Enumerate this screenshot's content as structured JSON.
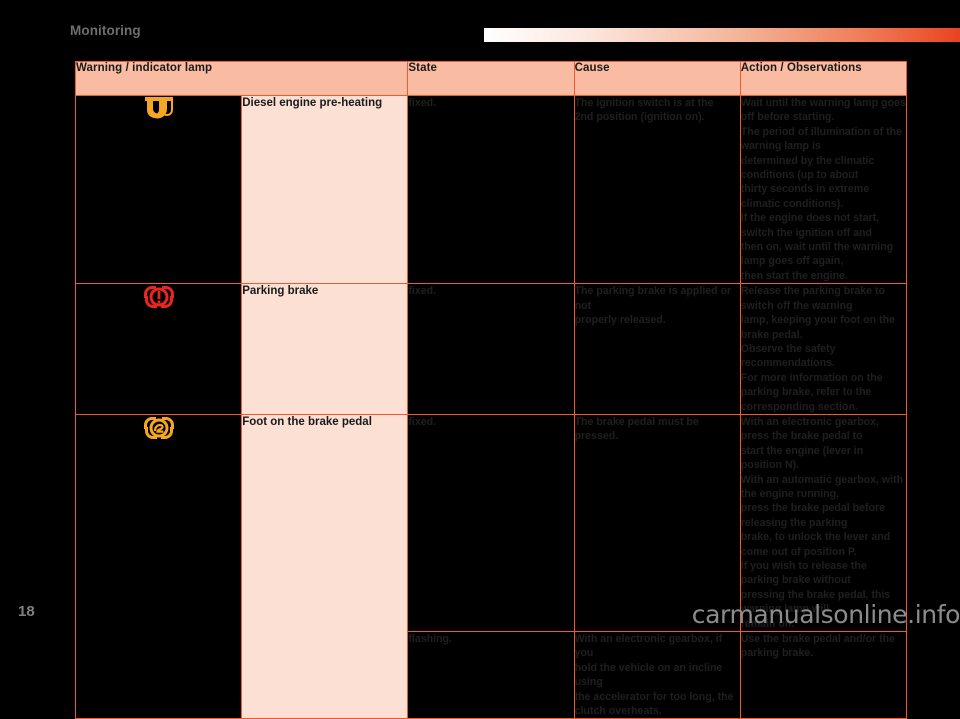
{
  "header": {
    "section_title": "Monitoring",
    "gradient_bar": {
      "from": "#ffffff",
      "to": "#e8441f"
    }
  },
  "colors": {
    "table_border": "#ef5a32",
    "header_fill": "#f9bba1",
    "name_fill": "#fce0d4",
    "cell_fill": "#000000",
    "amber_lamp": "#f5a623",
    "red_lamp": "#e8251f",
    "title_gray": "#6e6e6e"
  },
  "table": {
    "columns": [
      {
        "key": "lamp",
        "label": "Warning / indicator lamp"
      },
      {
        "key": "state",
        "label": "State"
      },
      {
        "key": "cause",
        "label": "Cause"
      },
      {
        "key": "action",
        "label": "Action / Observations"
      }
    ],
    "rows": [
      {
        "icon_name": "diesel-preheating-lamp-icon",
        "icon_color": "#f5a623",
        "name": "Diesel engine\npre-heating",
        "state": "fixed.",
        "cause": "The ignition switch is at the\n2nd position (ignition on).",
        "action": "Wait until the warning lamp goes off before starting.\nThe period of illumination of the warning lamp is\ndetermined by the climatic conditions (up to about\nthirty seconds in extreme climatic conditions).\nIf the engine does not start, switch the ignition off and\nthen on, wait until the warning lamp goes off again,\nthen start the engine."
      },
      {
        "icon_name": "parking-brake-lamp-icon",
        "icon_color": "#e8251f",
        "name": "Parking brake",
        "state": "fixed.",
        "cause": "The parking brake is applied or not\nproperly released.",
        "action": "Release the parking brake to switch off the warning\nlamp, keeping your foot on the brake pedal.\nObserve the safety recommendations.\nFor more information on the parking brake, refer to the\ncorresponding section."
      },
      {
        "icon_name": "foot-on-brake-pedal-lamp-icon",
        "icon_color": "#f5a623",
        "name": "Foot on the\nbrake pedal",
        "state": "fixed.",
        "cause": "The brake pedal must be pressed.",
        "action": "With an electronic gearbox, press the brake pedal to\nstart the engine (lever in position N).\nWith an automatic gearbox, with the engine running,\npress the brake pedal before releasing the parking\nbrake, to unlock the lever and come out of position P.\nIf you wish to release the parking brake without\npressing the brake pedal, this warning lamp will\nremain on."
      },
      {
        "icon_name": "",
        "icon_color": "",
        "name": "",
        "state": "flashing.",
        "cause": "With an electronic gearbox, if you\nhold the vehicle on an incline using\nthe accelerator for too long, the\nclutch overheats.",
        "action": "Use the brake pedal and/or the parking brake."
      }
    ]
  },
  "footer": {
    "page_number": "18",
    "watermark": "carmanualsonline.info"
  }
}
